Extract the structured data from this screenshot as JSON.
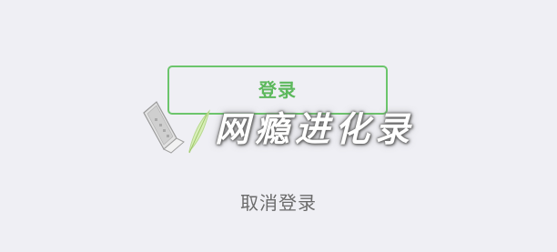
{
  "login": {
    "button_label": "登录",
    "cancel_label": "取消登录",
    "accent_color": "#6cc56c"
  },
  "watermark": {
    "text": "网瘾进化录",
    "logo_icon": "laptop-feather-icon"
  }
}
